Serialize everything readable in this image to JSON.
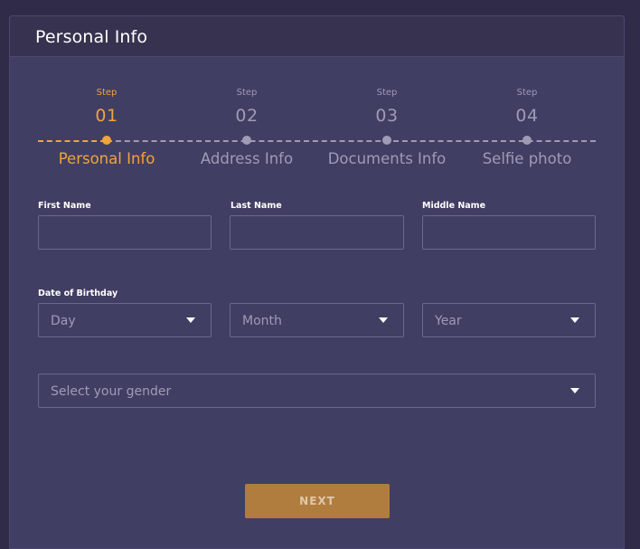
{
  "header": {
    "title": "Personal Info"
  },
  "steps": [
    {
      "kicker": "Step",
      "number": "01",
      "label": "Personal Info",
      "active": true
    },
    {
      "kicker": "Step",
      "number": "02",
      "label": "Address Info",
      "active": false
    },
    {
      "kicker": "Step",
      "number": "03",
      "label": "Documents Info",
      "active": false
    },
    {
      "kicker": "Step",
      "number": "04",
      "label": "Selfie photo",
      "active": false
    }
  ],
  "form": {
    "first_name": {
      "label": "First Name",
      "value": ""
    },
    "last_name": {
      "label": "Last Name",
      "value": ""
    },
    "middle_name": {
      "label": "Middle Name",
      "value": ""
    },
    "dob": {
      "label": "Date of Birthday",
      "day": "Day",
      "month": "Month",
      "year": "Year"
    },
    "gender": {
      "placeholder": "Select your gender"
    }
  },
  "actions": {
    "next_label": "NEXT"
  },
  "colors": {
    "accent": "#f0a43a",
    "inactive": "#9e9cb5",
    "card_bg": "#413e63",
    "button_bg": "#b07d3f"
  }
}
